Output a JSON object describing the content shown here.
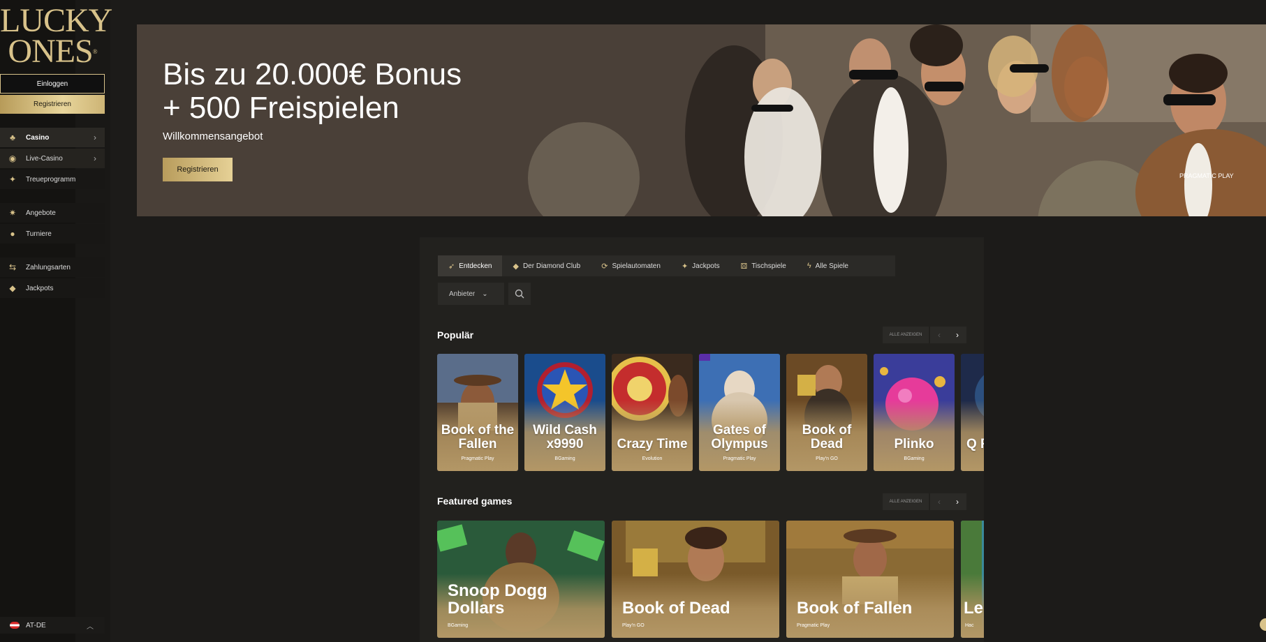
{
  "sidebar": {
    "logo": {
      "line1": "LUCKY",
      "line2": "ONES",
      "mark": "®"
    },
    "login_label": "Einloggen",
    "register_label": "Registrieren",
    "items": [
      {
        "label": "Casino",
        "icon": "casino-icon",
        "has_chevron": true
      },
      {
        "label": "Live-Casino",
        "icon": "live-casino-icon",
        "has_chevron": true
      },
      {
        "label": "Treueprogramm",
        "icon": "sparkle-icon",
        "has_chevron": false
      },
      {
        "label": "Angebote",
        "icon": "party-icon",
        "has_chevron": false
      },
      {
        "label": "Turniere",
        "icon": "trophy-icon",
        "has_chevron": false
      },
      {
        "label": "Zahlungsarten",
        "icon": "transfer-icon",
        "has_chevron": false
      },
      {
        "label": "Jackpots",
        "icon": "diamond-icon",
        "has_chevron": false
      }
    ],
    "locale": "AT-DE"
  },
  "hero": {
    "title_line1": "Bis zu 20.000€ Bonus",
    "title_line2": "+ 500 Freispielen",
    "subtitle": "Willkommensangebot",
    "cta": "Registrieren",
    "provider": "PRAGMATIC PLAY"
  },
  "tabs": [
    {
      "label": "Entdecken",
      "icon": "rocket-icon",
      "active": true
    },
    {
      "label": "Der Diamond Club",
      "icon": "diamond-icon",
      "active": false
    },
    {
      "label": "Spielautomaten",
      "icon": "slot-icon",
      "active": false
    },
    {
      "label": "Jackpots",
      "icon": "sparkle-icon",
      "active": false
    },
    {
      "label": "Tischspiele",
      "icon": "dice-icon",
      "active": false
    },
    {
      "label": "Alle Spiele",
      "icon": "lightning-icon",
      "active": false
    }
  ],
  "filters": {
    "provider_label": "Anbieter"
  },
  "sections": {
    "popular": {
      "title": "Populär",
      "see_all": "ALLE ANZEIGEN",
      "games": [
        {
          "name": "Book of the Fallen",
          "provider": "Pragmatic Play"
        },
        {
          "name": "Wild Cash x9990",
          "provider": "BGaming"
        },
        {
          "name": "Crazy Time",
          "provider": "Evolution"
        },
        {
          "name": "Gates of Olympus",
          "provider": "Pragmatic Play"
        },
        {
          "name": "Book of Dead",
          "provider": "Play'n GO"
        },
        {
          "name": "Plinko",
          "provider": "BGaming"
        },
        {
          "name": "Q R",
          "provider": ""
        }
      ]
    },
    "featured": {
      "title": "Featured games",
      "see_all": "ALLE ANZEIGEN",
      "games": [
        {
          "name": "Snoop Dogg Dollars",
          "provider": "BGaming"
        },
        {
          "name": "Book of Dead",
          "provider": "Play'n GO"
        },
        {
          "name": "Book of Fallen",
          "provider": "Pragmatic Play"
        },
        {
          "name": "Le",
          "provider": "Hac"
        }
      ]
    }
  },
  "colors": {
    "accent_gold": "#d8c28a",
    "background": "#1c1b19",
    "panel": "#22211e"
  }
}
